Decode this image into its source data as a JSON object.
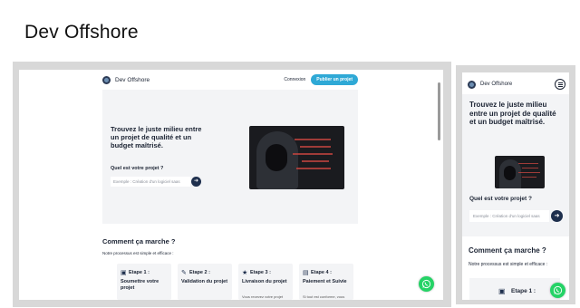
{
  "page": {
    "title": "Dev Offshore"
  },
  "desktop": {
    "nav": {
      "brand": "Dev Offshore",
      "login": "Connexion",
      "publish": "Publier un projet"
    },
    "hero": {
      "title": "Trouvez le juste milieu entre un projet de qualité et un budget maîtrisé.",
      "question": "Quel est votre projet ?",
      "placeholder": "Exemple : Création d'un logiciel saas",
      "go": "➜"
    },
    "section": {
      "title": "Comment ça marche ?",
      "subtitle": "Notre processus est simple et efficace :"
    },
    "steps": [
      {
        "label": "Etape 1 :",
        "name": "Soumettre votre projet",
        "desc": "",
        "icon": "document-icon"
      },
      {
        "label": "Etape 2 :",
        "name": "Validation du projet",
        "desc": "",
        "icon": "edit-document-icon"
      },
      {
        "label": "Etape 3 :",
        "name": "Livraison du projet",
        "desc": "Vous recevez votre projet",
        "icon": "star-icon"
      },
      {
        "label": "Etape 4 :",
        "name": "Paiement et Suivie",
        "desc": "Si tout est conforme, vous",
        "icon": "money-icon"
      }
    ]
  },
  "mobile": {
    "brand": "Dev Offshore",
    "hero": {
      "title": "Trouvez le juste milieu entre un projet de qualité et un budget maîtrisé.",
      "question": "Quel est votre projet ?",
      "placeholder": "Exemple : Création d'un logiciel saas",
      "go": "➜"
    },
    "section": {
      "title": "Comment ça marche ?",
      "subtitle": "Notre processus est simple et efficace :"
    },
    "step": {
      "label": "Etape 1 :",
      "icon": "document-icon"
    }
  },
  "colors": {
    "accent": "#2fa9d6",
    "navy": "#1e2f4d",
    "whatsapp": "#25d366",
    "hero_bg": "#f3f4f6"
  }
}
